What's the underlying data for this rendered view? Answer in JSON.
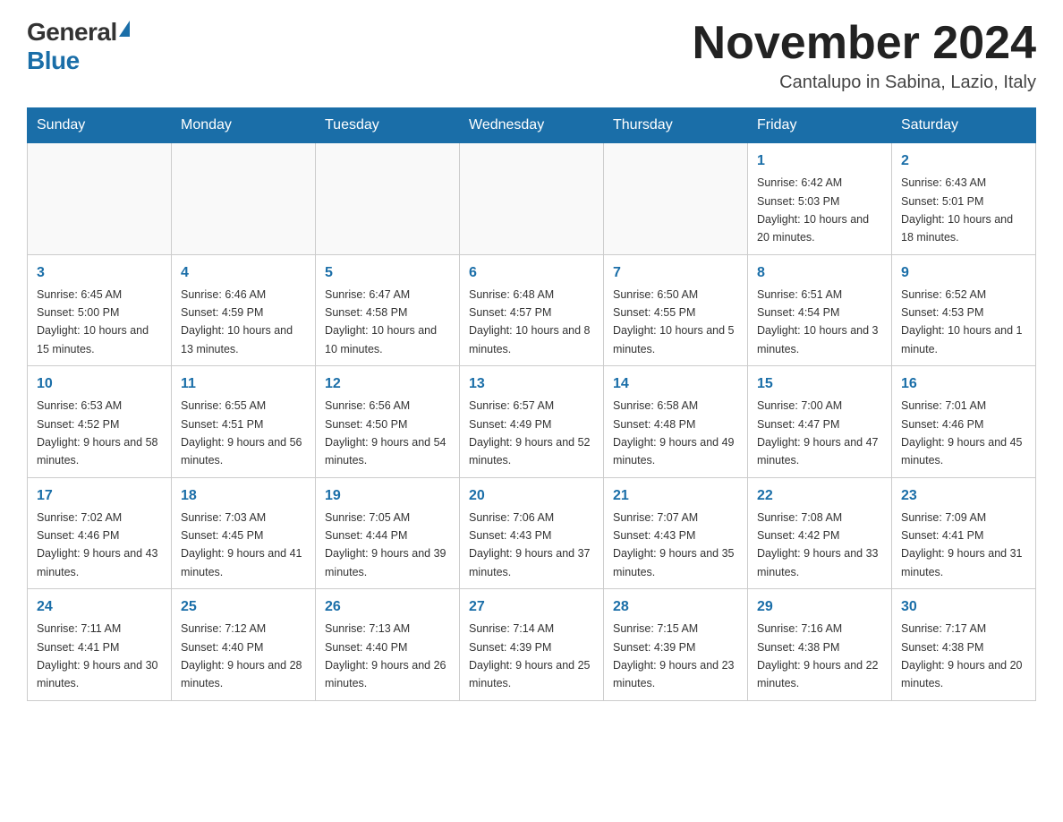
{
  "logo": {
    "general": "General",
    "blue": "Blue"
  },
  "title": "November 2024",
  "location": "Cantalupo in Sabina, Lazio, Italy",
  "days_of_week": [
    "Sunday",
    "Monday",
    "Tuesday",
    "Wednesday",
    "Thursday",
    "Friday",
    "Saturday"
  ],
  "weeks": [
    [
      {
        "day": "",
        "info": ""
      },
      {
        "day": "",
        "info": ""
      },
      {
        "day": "",
        "info": ""
      },
      {
        "day": "",
        "info": ""
      },
      {
        "day": "",
        "info": ""
      },
      {
        "day": "1",
        "info": "Sunrise: 6:42 AM\nSunset: 5:03 PM\nDaylight: 10 hours and 20 minutes."
      },
      {
        "day": "2",
        "info": "Sunrise: 6:43 AM\nSunset: 5:01 PM\nDaylight: 10 hours and 18 minutes."
      }
    ],
    [
      {
        "day": "3",
        "info": "Sunrise: 6:45 AM\nSunset: 5:00 PM\nDaylight: 10 hours and 15 minutes."
      },
      {
        "day": "4",
        "info": "Sunrise: 6:46 AM\nSunset: 4:59 PM\nDaylight: 10 hours and 13 minutes."
      },
      {
        "day": "5",
        "info": "Sunrise: 6:47 AM\nSunset: 4:58 PM\nDaylight: 10 hours and 10 minutes."
      },
      {
        "day": "6",
        "info": "Sunrise: 6:48 AM\nSunset: 4:57 PM\nDaylight: 10 hours and 8 minutes."
      },
      {
        "day": "7",
        "info": "Sunrise: 6:50 AM\nSunset: 4:55 PM\nDaylight: 10 hours and 5 minutes."
      },
      {
        "day": "8",
        "info": "Sunrise: 6:51 AM\nSunset: 4:54 PM\nDaylight: 10 hours and 3 minutes."
      },
      {
        "day": "9",
        "info": "Sunrise: 6:52 AM\nSunset: 4:53 PM\nDaylight: 10 hours and 1 minute."
      }
    ],
    [
      {
        "day": "10",
        "info": "Sunrise: 6:53 AM\nSunset: 4:52 PM\nDaylight: 9 hours and 58 minutes."
      },
      {
        "day": "11",
        "info": "Sunrise: 6:55 AM\nSunset: 4:51 PM\nDaylight: 9 hours and 56 minutes."
      },
      {
        "day": "12",
        "info": "Sunrise: 6:56 AM\nSunset: 4:50 PM\nDaylight: 9 hours and 54 minutes."
      },
      {
        "day": "13",
        "info": "Sunrise: 6:57 AM\nSunset: 4:49 PM\nDaylight: 9 hours and 52 minutes."
      },
      {
        "day": "14",
        "info": "Sunrise: 6:58 AM\nSunset: 4:48 PM\nDaylight: 9 hours and 49 minutes."
      },
      {
        "day": "15",
        "info": "Sunrise: 7:00 AM\nSunset: 4:47 PM\nDaylight: 9 hours and 47 minutes."
      },
      {
        "day": "16",
        "info": "Sunrise: 7:01 AM\nSunset: 4:46 PM\nDaylight: 9 hours and 45 minutes."
      }
    ],
    [
      {
        "day": "17",
        "info": "Sunrise: 7:02 AM\nSunset: 4:46 PM\nDaylight: 9 hours and 43 minutes."
      },
      {
        "day": "18",
        "info": "Sunrise: 7:03 AM\nSunset: 4:45 PM\nDaylight: 9 hours and 41 minutes."
      },
      {
        "day": "19",
        "info": "Sunrise: 7:05 AM\nSunset: 4:44 PM\nDaylight: 9 hours and 39 minutes."
      },
      {
        "day": "20",
        "info": "Sunrise: 7:06 AM\nSunset: 4:43 PM\nDaylight: 9 hours and 37 minutes."
      },
      {
        "day": "21",
        "info": "Sunrise: 7:07 AM\nSunset: 4:43 PM\nDaylight: 9 hours and 35 minutes."
      },
      {
        "day": "22",
        "info": "Sunrise: 7:08 AM\nSunset: 4:42 PM\nDaylight: 9 hours and 33 minutes."
      },
      {
        "day": "23",
        "info": "Sunrise: 7:09 AM\nSunset: 4:41 PM\nDaylight: 9 hours and 31 minutes."
      }
    ],
    [
      {
        "day": "24",
        "info": "Sunrise: 7:11 AM\nSunset: 4:41 PM\nDaylight: 9 hours and 30 minutes."
      },
      {
        "day": "25",
        "info": "Sunrise: 7:12 AM\nSunset: 4:40 PM\nDaylight: 9 hours and 28 minutes."
      },
      {
        "day": "26",
        "info": "Sunrise: 7:13 AM\nSunset: 4:40 PM\nDaylight: 9 hours and 26 minutes."
      },
      {
        "day": "27",
        "info": "Sunrise: 7:14 AM\nSunset: 4:39 PM\nDaylight: 9 hours and 25 minutes."
      },
      {
        "day": "28",
        "info": "Sunrise: 7:15 AM\nSunset: 4:39 PM\nDaylight: 9 hours and 23 minutes."
      },
      {
        "day": "29",
        "info": "Sunrise: 7:16 AM\nSunset: 4:38 PM\nDaylight: 9 hours and 22 minutes."
      },
      {
        "day": "30",
        "info": "Sunrise: 7:17 AM\nSunset: 4:38 PM\nDaylight: 9 hours and 20 minutes."
      }
    ]
  ]
}
